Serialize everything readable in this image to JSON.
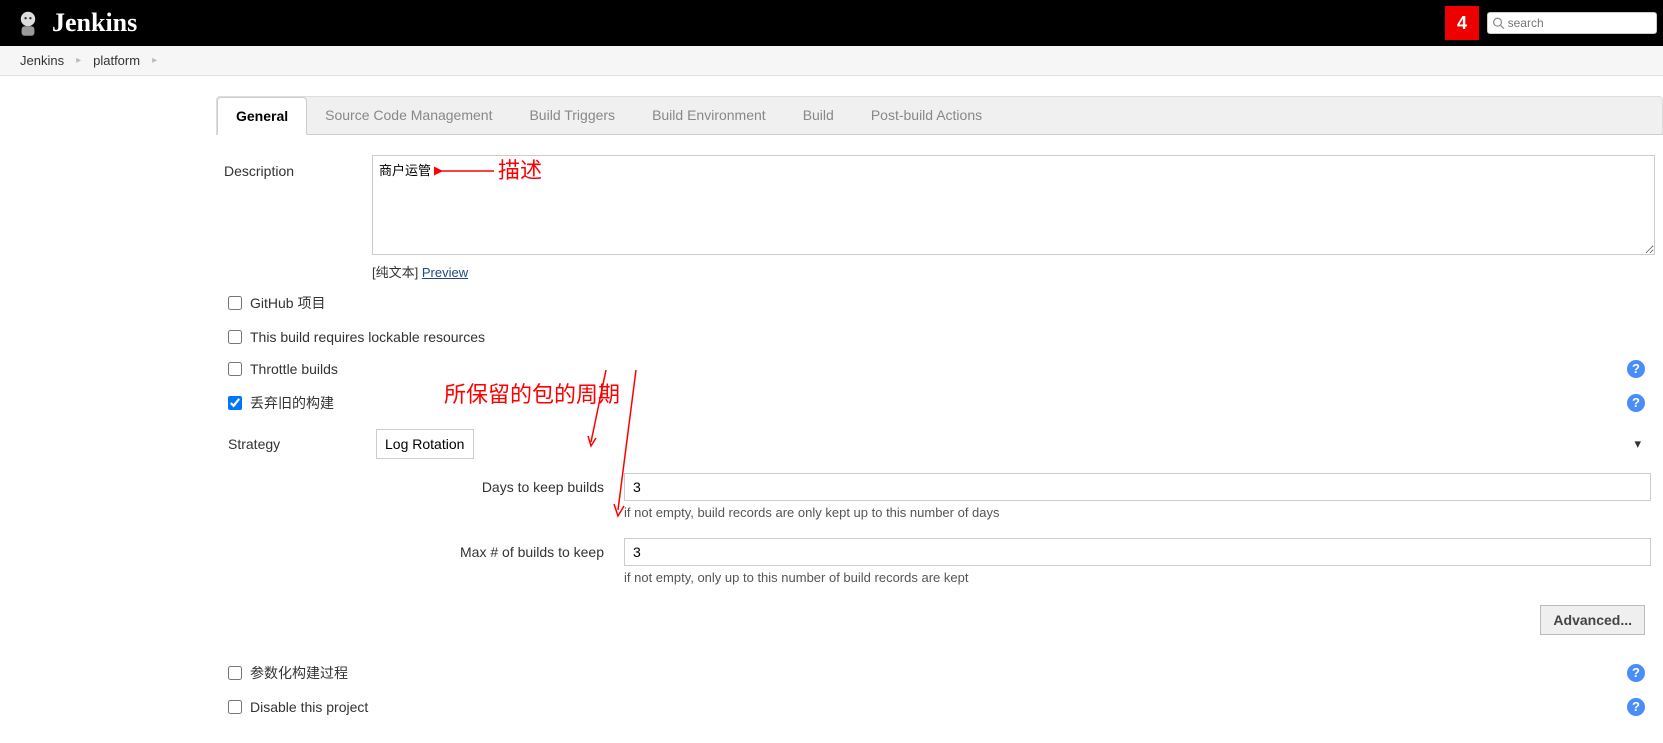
{
  "header": {
    "title": "Jenkins",
    "notif_count": "4",
    "search_placeholder": "search"
  },
  "breadcrumb": {
    "items": [
      "Jenkins",
      "platform"
    ]
  },
  "tabs": [
    {
      "label": "General",
      "active": true
    },
    {
      "label": "Source Code Management",
      "active": false
    },
    {
      "label": "Build Triggers",
      "active": false
    },
    {
      "label": "Build Environment",
      "active": false
    },
    {
      "label": "Build",
      "active": false
    },
    {
      "label": "Post-build Actions",
      "active": false
    }
  ],
  "form": {
    "description_label": "Description",
    "description_value": "商户运管",
    "preview_prefix": "[纯文本] ",
    "preview_link": "Preview",
    "checkboxes": {
      "github_project": {
        "label": "GitHub 项目",
        "checked": false
      },
      "lockable": {
        "label": "This build requires lockable resources",
        "checked": false
      },
      "throttle": {
        "label": "Throttle builds",
        "checked": false
      },
      "discard_old": {
        "label": "丢弃旧的构建",
        "checked": true
      },
      "param_build": {
        "label": "参数化构建过程",
        "checked": false
      },
      "disable_project": {
        "label": "Disable this project",
        "checked": false
      }
    },
    "strategy_label": "Strategy",
    "strategy_value": "Log Rotation",
    "days_to_keep_label": "Days to keep builds",
    "days_to_keep_value": "3",
    "days_to_keep_hint": "if not empty, build records are only kept up to this number of days",
    "max_builds_label": "Max # of builds to keep",
    "max_builds_value": "3",
    "max_builds_hint": "if not empty, only up to this number of build records are kept",
    "advanced_btn": "Advanced..."
  },
  "annotations": {
    "desc_arrow_label": "描述",
    "retain_label": "所保留的包的周期"
  }
}
